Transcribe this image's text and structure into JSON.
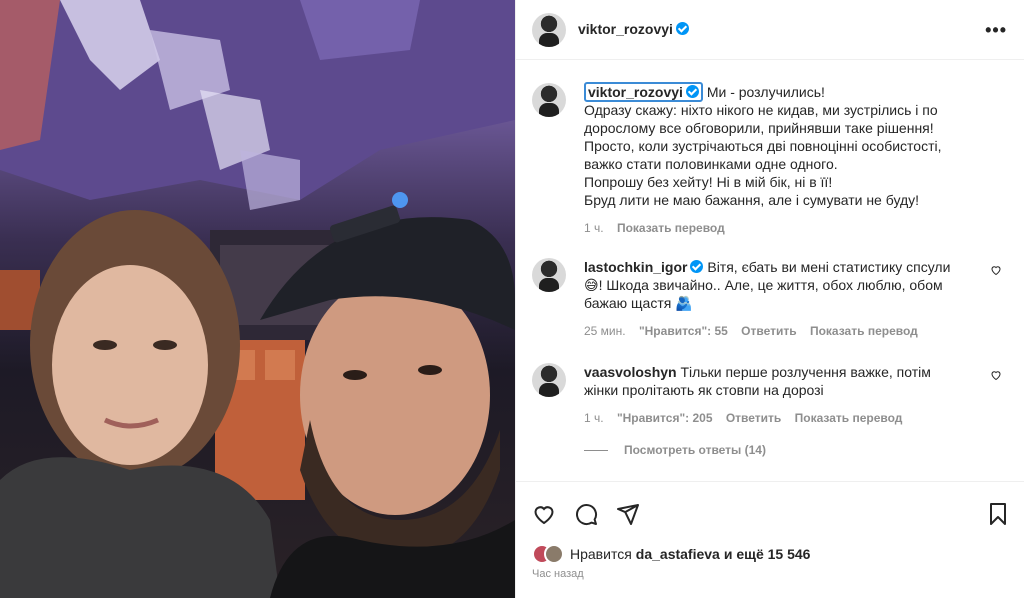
{
  "header": {
    "username": "viktor_rozovyi",
    "more_label": "•••"
  },
  "caption": {
    "username": "viktor_rozovyi",
    "first_line": "Ми - розлучились!",
    "lines": [
      "Одразу скажу: ніхто нікого не кидав, ми зустрілись і по",
      "дорослому все обговорили, прийнявши таке рішення!",
      "Просто, коли зустрічаються дві повноцінні особистості,",
      "важко стати половинками одне одного.",
      "Попрошу без хейту! Ні в мій бік, ні в її!",
      "Бруд лити не маю бажання, але і сумувати не буду!"
    ],
    "time": "1 ч.",
    "translate": "Показать перевод"
  },
  "comments": [
    {
      "username": "lastochkin_igor",
      "lines": [
        "Вітя, єбать ви мені статистику спсули",
        "😅! Шкода звичайно.. Але, це життя, обох люблю, обом",
        "бажаю щастя 🫂"
      ],
      "time": "25 мин.",
      "likes": "\"Нравится\": 55",
      "reply": "Ответить",
      "translate": "Показать перевод"
    },
    {
      "username": "vaasvoloshyn",
      "lines": [
        "Тільки перше розлучення важке, потім",
        "жінки пролітають як стовпи на дорозі"
      ],
      "time": "1 ч.",
      "likes": "\"Нравится\": 205",
      "reply": "Ответить",
      "translate": "Показать перевод"
    }
  ],
  "view_replies": "Посмотреть ответы (14)",
  "likes_line": {
    "prefix": "Нравится",
    "user": "da_astafieva",
    "suffix": "и ещё 15 546"
  },
  "posted": "Час назад",
  "colors": {
    "verified": "#0095f6",
    "muted": "#8e8e8e",
    "text": "#262626"
  }
}
